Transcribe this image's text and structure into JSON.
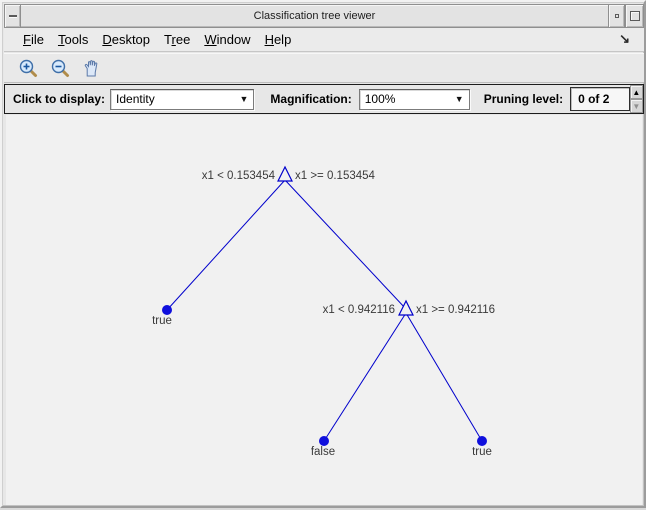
{
  "title_bar": {
    "title": "Classification tree viewer"
  },
  "menu_bar": {
    "items": [
      {
        "pre": "",
        "key": "F",
        "post": "ile"
      },
      {
        "pre": "",
        "key": "T",
        "post": "ools"
      },
      {
        "pre": "",
        "key": "D",
        "post": "esktop"
      },
      {
        "pre": "T",
        "key": "r",
        "post": "ee"
      },
      {
        "pre": "",
        "key": "W",
        "post": "indow"
      },
      {
        "pre": "",
        "key": "H",
        "post": "elp"
      }
    ],
    "dock_arrow_glyph": "↘"
  },
  "toolbar": {
    "buttons": [
      {
        "icon": "zoom-in-icon"
      },
      {
        "icon": "zoom-out-icon"
      },
      {
        "icon": "pan-hand-icon"
      }
    ]
  },
  "controls": {
    "display": {
      "label": "Click to display:",
      "value": "Identity"
    },
    "magnification": {
      "label": "Magnification:",
      "value": "100%"
    },
    "pruning": {
      "label": "Pruning level:",
      "value": "0 of 2"
    },
    "dropdown_arrow_glyph": "▼",
    "spinner_up_glyph": "▲",
    "spinner_down_glyph": "▼"
  },
  "tree": {
    "nodes": {
      "root": {
        "type": "branch",
        "left_label": "x1 < 0.153454",
        "right_label": "x1 >= 0.153454"
      },
      "leaf_left": {
        "type": "leaf",
        "label": "true"
      },
      "node2": {
        "type": "branch",
        "left_label": "x1 < 0.942116",
        "right_label": "x1 >= 0.942116"
      },
      "leaf_false": {
        "type": "leaf",
        "label": "false"
      },
      "leaf_true": {
        "type": "leaf",
        "label": "true"
      }
    },
    "colors": {
      "edge": "#0000cc",
      "marker": "#0f0fdd",
      "label_text": "#3a3a3a"
    }
  }
}
